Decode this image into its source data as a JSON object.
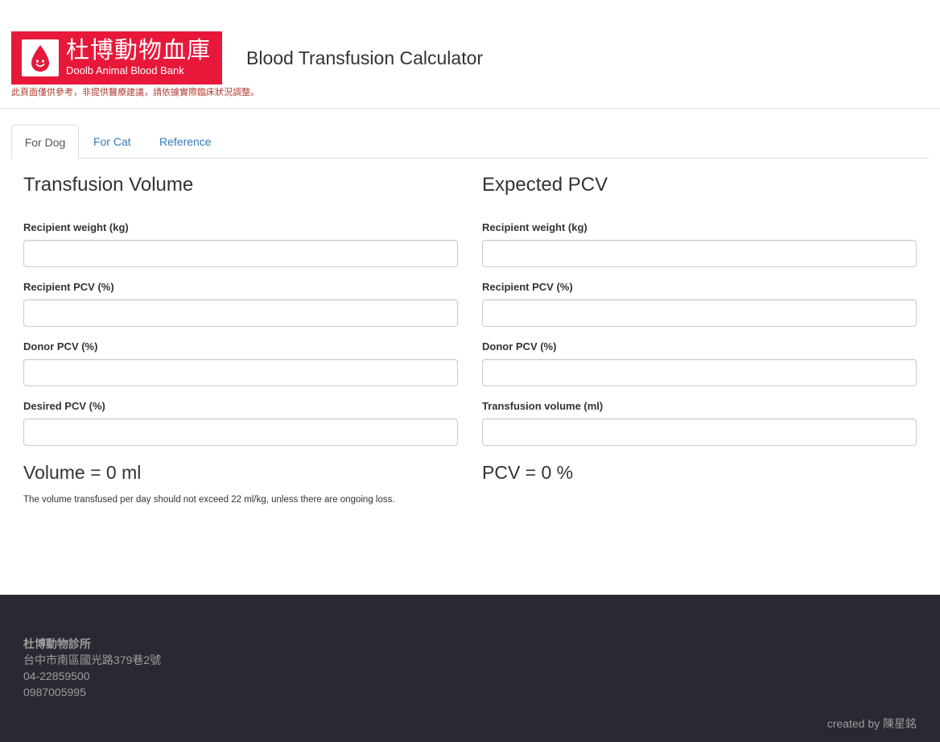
{
  "header": {
    "logo_zh": "杜博動物血庫",
    "logo_en": "Doolb Animal Blood Bank",
    "title": "Blood Transfusion Calculator",
    "disclaimer": "此頁面僅供參考，非提供醫療建議，請依據實際臨床狀況調整。",
    "brand_color": "#e8183b"
  },
  "tabs": [
    {
      "label": "For Dog",
      "active": true
    },
    {
      "label": "For Cat",
      "active": false
    },
    {
      "label": "Reference",
      "active": false
    }
  ],
  "volume_panel": {
    "title": "Transfusion Volume",
    "fields": [
      {
        "label": "Recipient weight (kg)",
        "value": ""
      },
      {
        "label": "Recipient PCV (%)",
        "value": ""
      },
      {
        "label": "Donor PCV (%)",
        "value": ""
      },
      {
        "label": "Desired PCV (%)",
        "value": ""
      }
    ],
    "result": "Volume = 0 ml",
    "note": "The volume transfused per day should not exceed 22 ml/kg, unless there are ongoing loss."
  },
  "pcv_panel": {
    "title": "Expected PCV",
    "fields": [
      {
        "label": "Recipient weight (kg)",
        "value": ""
      },
      {
        "label": "Recipient PCV (%)",
        "value": ""
      },
      {
        "label": "Donor PCV (%)",
        "value": ""
      },
      {
        "label": "Transfusion volume (ml)",
        "value": ""
      }
    ],
    "result": "PCV = 0 %"
  },
  "footer": {
    "name": "杜博動物診所",
    "address": "台中市南區國光路379巷2號",
    "phone1": "04-22859500",
    "phone2": "0987005995",
    "credit": "created by 陳星銘",
    "background": "#2a2832"
  }
}
